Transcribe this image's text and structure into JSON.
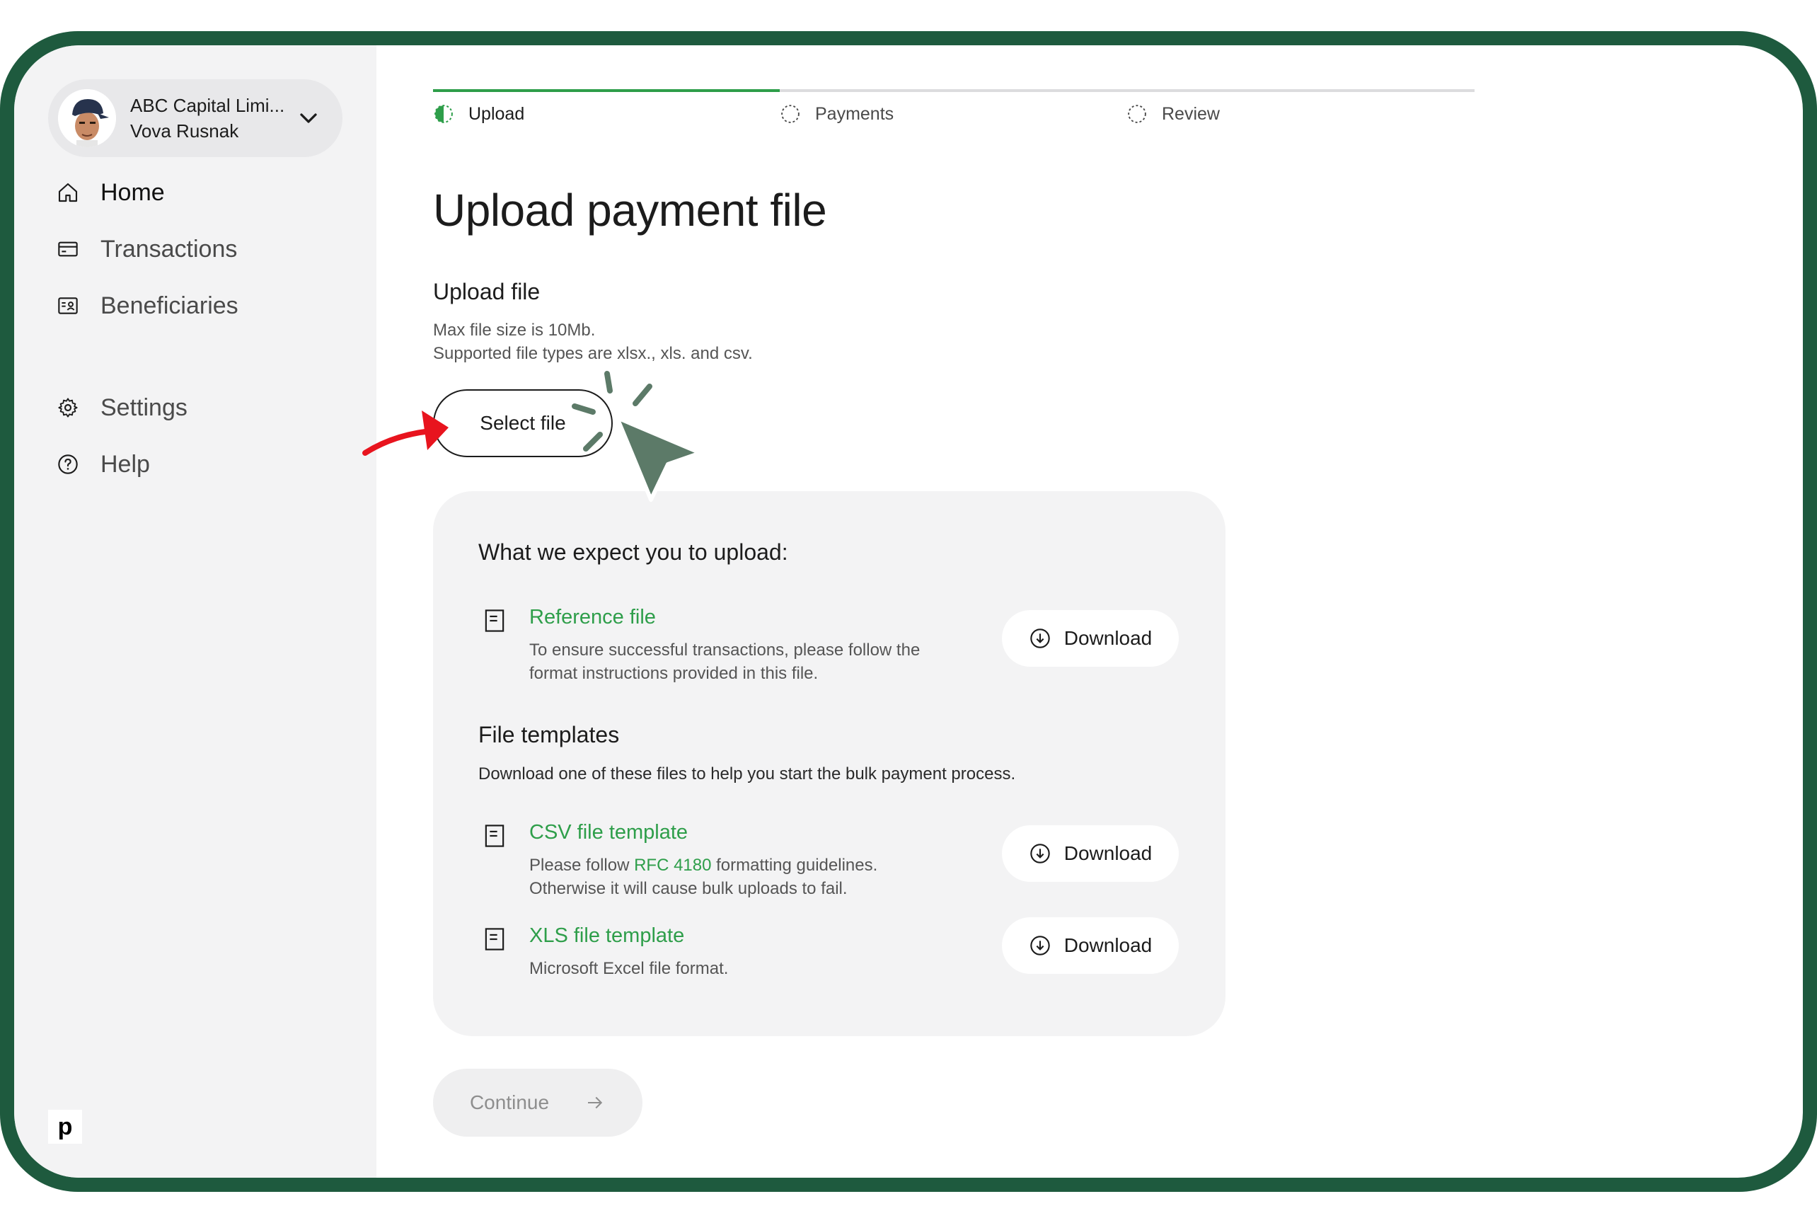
{
  "account": {
    "company": "ABC Capital Limi...",
    "user": "Vova Rusnak"
  },
  "sidebar": {
    "items": [
      {
        "label": "Home",
        "icon": "home-icon"
      },
      {
        "label": "Transactions",
        "icon": "card-icon"
      },
      {
        "label": "Beneficiaries",
        "icon": "contact-card-icon"
      },
      {
        "label": "Settings",
        "icon": "gear-icon"
      },
      {
        "label": "Help",
        "icon": "help-circle-icon"
      }
    ],
    "brand": "p"
  },
  "steps": [
    {
      "label": "Upload",
      "state": "in-progress"
    },
    {
      "label": "Payments",
      "state": "pending"
    },
    {
      "label": "Review",
      "state": "pending"
    }
  ],
  "main": {
    "title": "Upload payment file",
    "upload_title": "Upload file",
    "hint_line1": "Max file size is 10Mb.",
    "hint_line2": "Supported file types are xlsx., xls. and csv.",
    "select_label": "Select file",
    "continue_label": "Continue"
  },
  "card": {
    "title": "What we expect you to upload:",
    "reference": {
      "name": "Reference file",
      "desc_line1": "To ensure successful transactions, please follow the",
      "desc_line2": "format instructions provided in this file."
    },
    "templates_title": "File templates",
    "templates_desc": "Download one of these files to help you start the bulk payment process.",
    "csv": {
      "name": "CSV file template",
      "desc_pre": "Please follow ",
      "desc_link": "RFC 4180",
      "desc_post": " formatting guidelines.",
      "desc_line2": "Otherwise it will cause bulk uploads to fail."
    },
    "xls": {
      "name": "XLS file template",
      "desc_line1": "Microsoft Excel file format."
    },
    "download_label": "Download"
  },
  "colors": {
    "accent": "#2e9e4a",
    "frame": "#1e5a3e",
    "annotation_arrow": "#e8141e",
    "cursor": "#5c7a68"
  }
}
